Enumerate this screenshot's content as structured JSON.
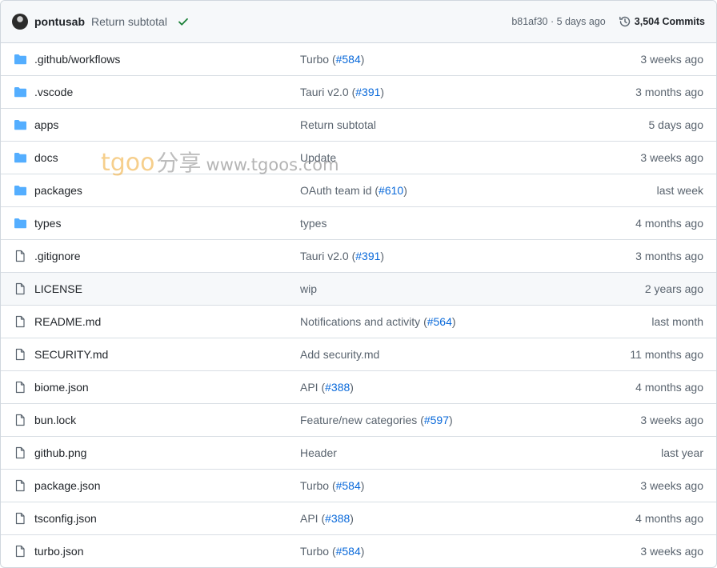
{
  "header": {
    "author": "pontusab",
    "message": "Return subtotal",
    "sha_time": "b81af30 · 5 days ago",
    "commits": "3,504 Commits"
  },
  "files": [
    {
      "type": "dir",
      "name": ".github/workflows",
      "commit": "Turbo (",
      "pr": "#584",
      "close": ")",
      "age": "3 weeks ago"
    },
    {
      "type": "dir",
      "name": ".vscode",
      "commit": "Tauri v2.0 (",
      "pr": "#391",
      "close": ")",
      "age": "3 months ago"
    },
    {
      "type": "dir",
      "name": "apps",
      "commit": "Return subtotal",
      "pr": "",
      "close": "",
      "age": "5 days ago"
    },
    {
      "type": "dir",
      "name": "docs",
      "commit": "Update",
      "pr": "",
      "close": "",
      "age": "3 weeks ago"
    },
    {
      "type": "dir",
      "name": "packages",
      "commit": "OAuth team id (",
      "pr": "#610",
      "close": ")",
      "age": "last week"
    },
    {
      "type": "dir",
      "name": "types",
      "commit": "types",
      "pr": "",
      "close": "",
      "age": "4 months ago"
    },
    {
      "type": "file",
      "name": ".gitignore",
      "commit": "Tauri v2.0 (",
      "pr": "#391",
      "close": ")",
      "age": "3 months ago"
    },
    {
      "type": "file",
      "name": "LICENSE",
      "commit": "wip",
      "pr": "",
      "close": "",
      "age": "2 years ago"
    },
    {
      "type": "file",
      "name": "README.md",
      "commit": "Notifications and activity (",
      "pr": "#564",
      "close": ")",
      "age": "last month"
    },
    {
      "type": "file",
      "name": "SECURITY.md",
      "commit": "Add security.md",
      "pr": "",
      "close": "",
      "age": "11 months ago"
    },
    {
      "type": "file",
      "name": "biome.json",
      "commit": "API (",
      "pr": "#388",
      "close": ")",
      "age": "4 months ago"
    },
    {
      "type": "file",
      "name": "bun.lock",
      "commit": "Feature/new categories (",
      "pr": "#597",
      "close": ")",
      "age": "3 weeks ago"
    },
    {
      "type": "file",
      "name": "github.png",
      "commit": "Header",
      "pr": "",
      "close": "",
      "age": "last year"
    },
    {
      "type": "file",
      "name": "package.json",
      "commit": "Turbo (",
      "pr": "#584",
      "close": ")",
      "age": "3 weeks ago"
    },
    {
      "type": "file",
      "name": "tsconfig.json",
      "commit": "API (",
      "pr": "#388",
      "close": ")",
      "age": "4 months ago"
    },
    {
      "type": "file",
      "name": "turbo.json",
      "commit": "Turbo (",
      "pr": "#584",
      "close": ")",
      "age": "3 weeks ago"
    }
  ],
  "watermark": {
    "brand": "tgoo",
    "cn": "分享",
    "url": "www.tgoos.com"
  },
  "colors": {
    "folder": "#54aeff",
    "file": "#59636e",
    "link": "#0969da",
    "success": "#1a7f37"
  }
}
